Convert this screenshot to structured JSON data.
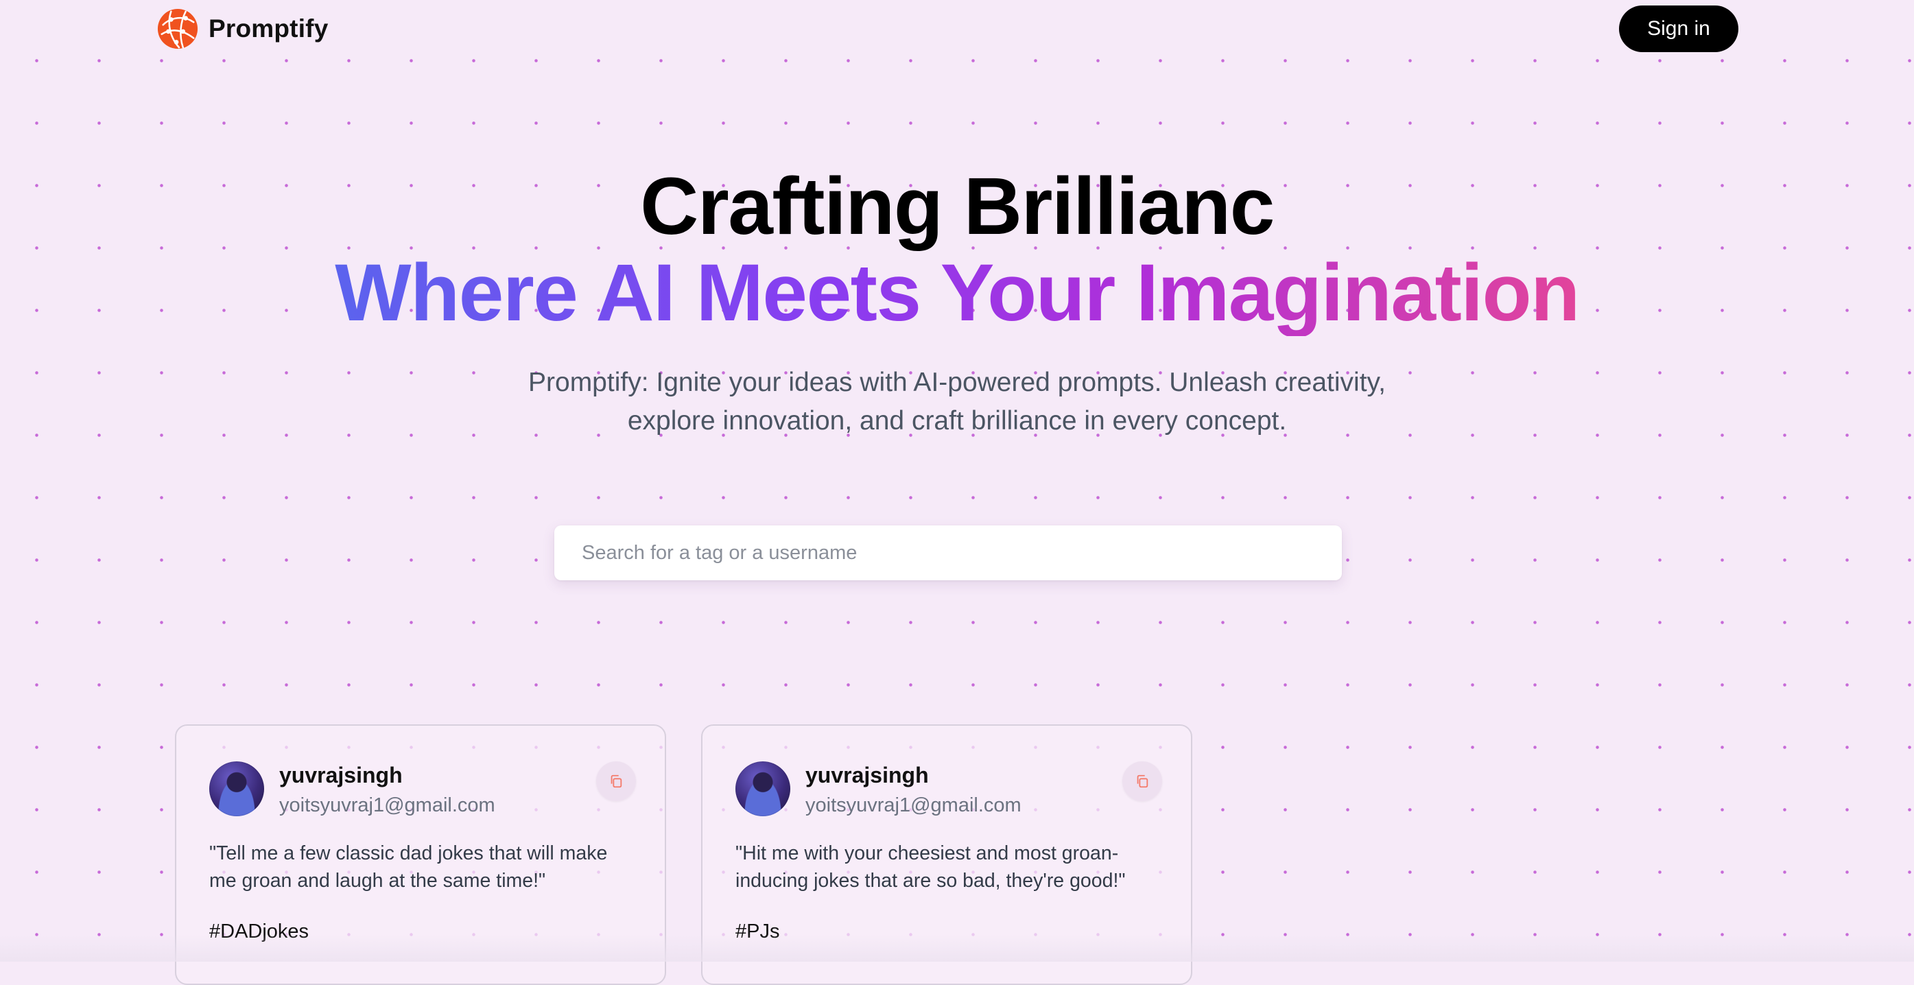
{
  "brand": {
    "name": "Promptify",
    "logo_icon": "globe-logo-icon",
    "logo_color": "#f0521f"
  },
  "nav": {
    "signin_label": "Sign in"
  },
  "hero": {
    "title": "Crafting Brillianc",
    "subtitle": "Where AI Meets Your Imagination",
    "description": "Promptify: Ignite your ideas with AI-powered prompts. Unleash creativity, explore innovation, and craft brilliance in every concept.",
    "gradient_colors": [
      "#5b63ee",
      "#8a3cf0",
      "#b02fd8",
      "#e2449b"
    ]
  },
  "search": {
    "placeholder": "Search for a tag or a username",
    "value": ""
  },
  "cards": [
    {
      "username": "yuvrajsingh",
      "email": "yoitsyuvraj1@gmail.com",
      "prompt": "\"Tell me a few classic dad jokes that will make me groan and laugh at the same time!\"",
      "tag": "#DADjokes",
      "copy_icon": "copy-icon"
    },
    {
      "username": "yuvrajsingh",
      "email": "yoitsyuvraj1@gmail.com",
      "prompt": "\"Hit me with your cheesiest and most groan-inducing jokes that are so bad, they're good!\"",
      "tag": "#PJs",
      "copy_icon": "copy-icon"
    }
  ],
  "colors": {
    "background": "#f6eaf8",
    "dot": "#c76ad8",
    "signin_bg": "#000000",
    "accent_copy": "#f47b6b"
  }
}
